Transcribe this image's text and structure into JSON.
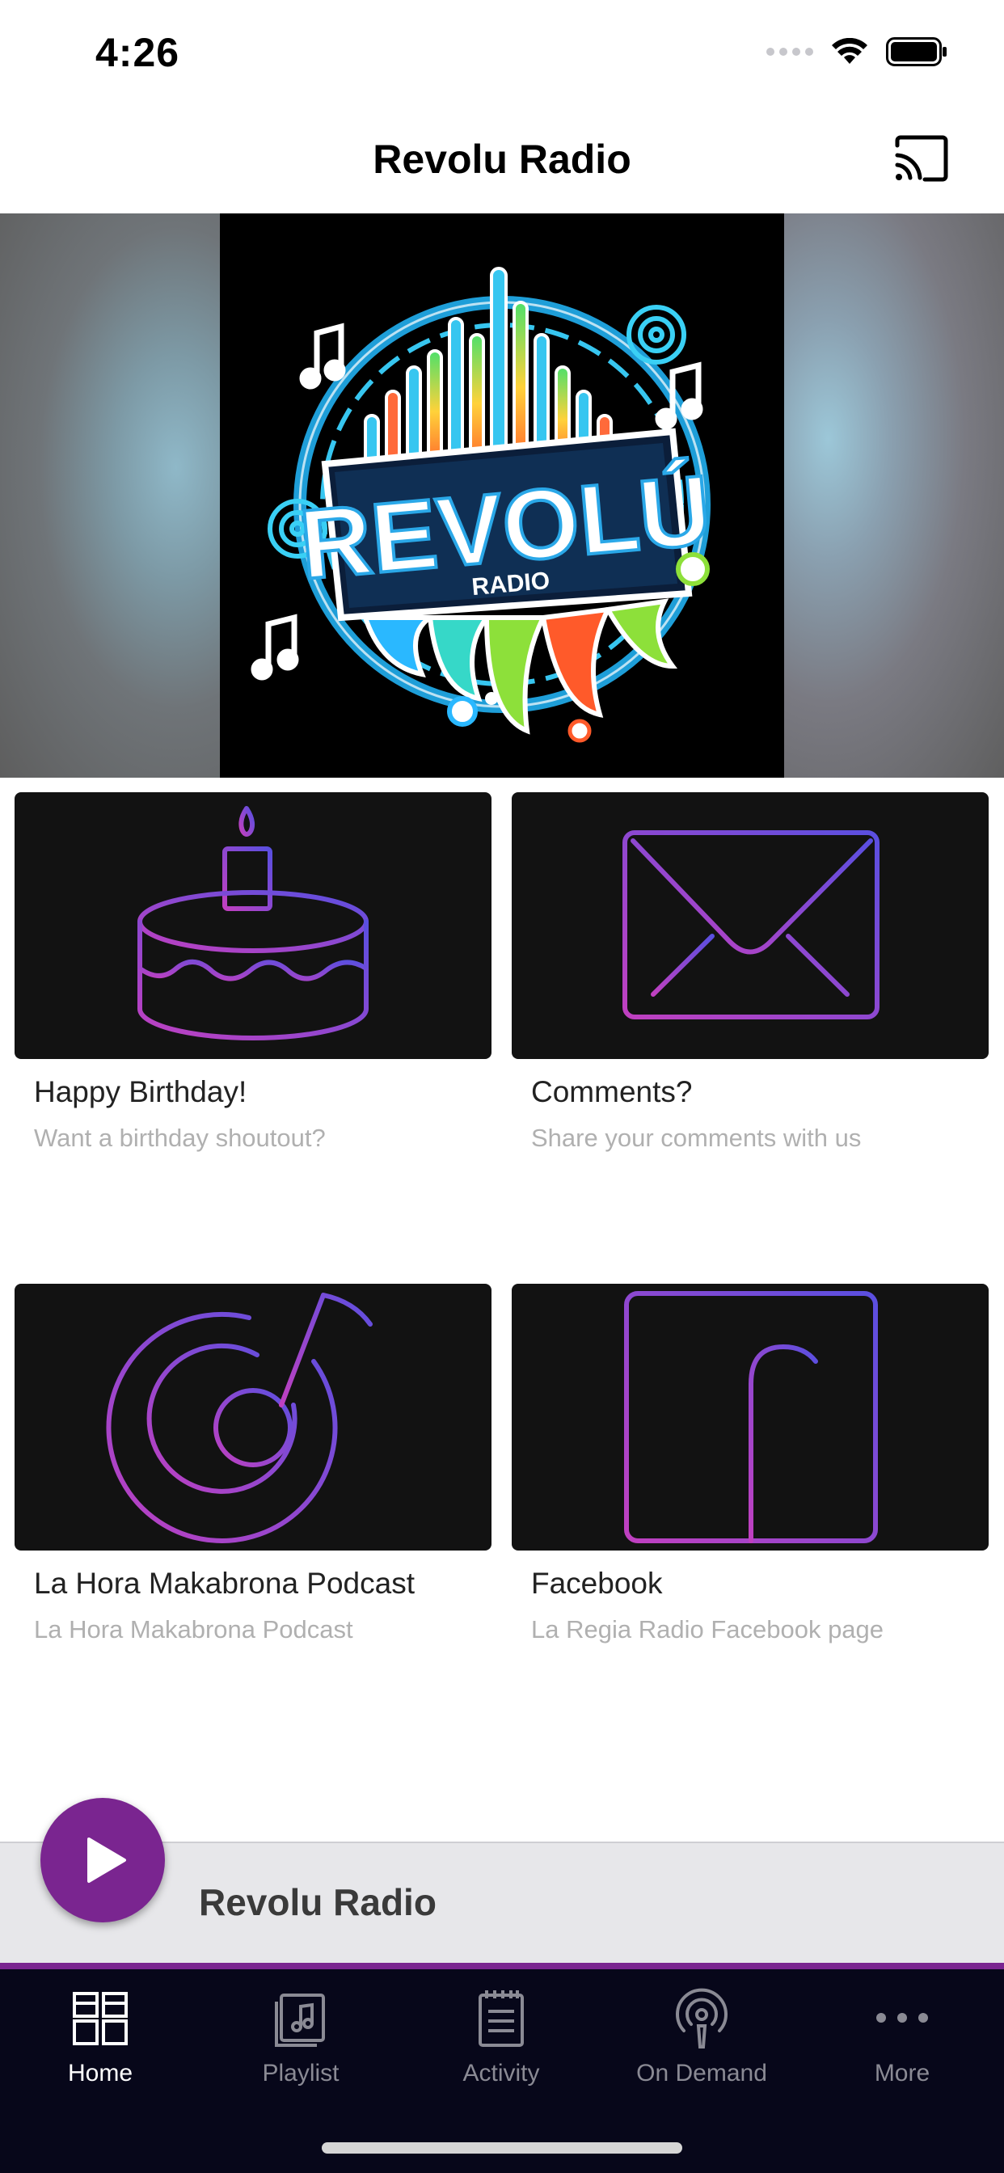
{
  "status_bar": {
    "time": "4:26"
  },
  "header": {
    "title": "Revolu Radio",
    "cast_icon": "cast-icon"
  },
  "hero": {
    "logo_text": "REVOLÚ",
    "logo_subtext": "RADIO"
  },
  "cards": [
    {
      "title": "Happy Birthday!",
      "subtitle": "Want a birthday shoutout?",
      "icon": "birthday-cake-icon"
    },
    {
      "title": "Comments?",
      "subtitle": "Share your comments with us",
      "icon": "envelope-icon"
    },
    {
      "title": "La Hora Makabrona Podcast",
      "subtitle": "La Hora Makabrona Podcast",
      "icon": "music-note-icon"
    },
    {
      "title": "Facebook",
      "subtitle": "La Regia Radio Facebook page",
      "icon": "facebook-icon"
    }
  ],
  "player": {
    "title": "Revolu Radio",
    "play_icon": "play-icon"
  },
  "tabs": [
    {
      "label": "Home",
      "icon": "grid-icon",
      "active": true
    },
    {
      "label": "Playlist",
      "icon": "playlist-icon",
      "active": false
    },
    {
      "label": "Activity",
      "icon": "notepad-icon",
      "active": false
    },
    {
      "label": "On Demand",
      "icon": "podcast-icon",
      "active": false
    },
    {
      "label": "More",
      "icon": "more-dots-icon",
      "active": false
    }
  ],
  "colors": {
    "accent": "#7a2590",
    "tab_bar_bg": "#07071a",
    "card_bg": "#121212",
    "gradient_start": "#c040c0",
    "gradient_end": "#5a4fe0"
  }
}
